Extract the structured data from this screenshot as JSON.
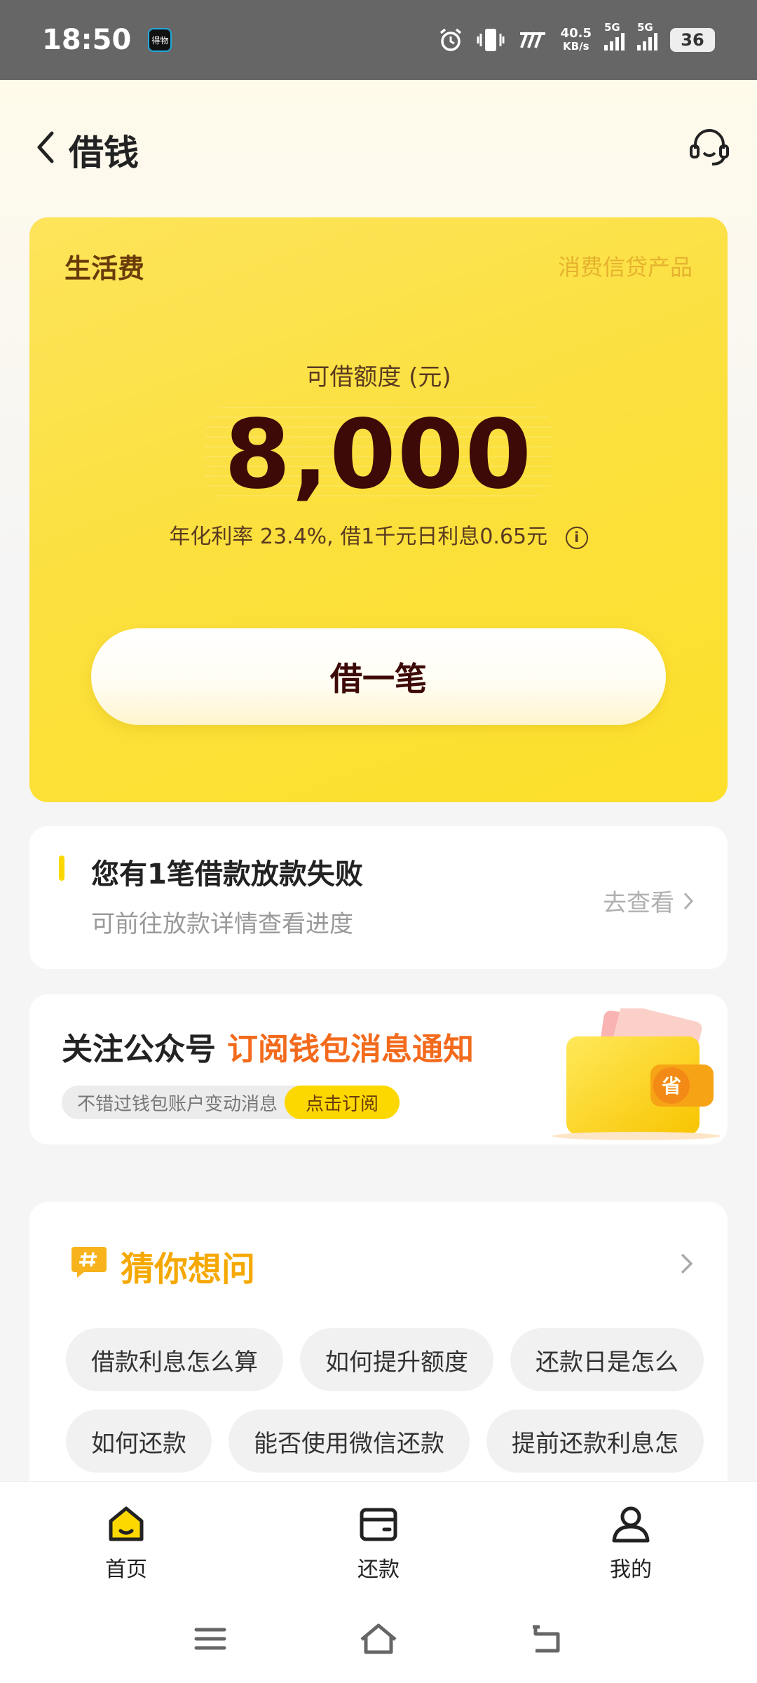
{
  "status_bar": {
    "time": "18:50",
    "app_badge": "得物",
    "net_speed_value": "40.5",
    "net_speed_unit": "KB/s",
    "signal1_label": "5G",
    "signal2_label": "5G",
    "battery": "36"
  },
  "header": {
    "title": "借钱"
  },
  "loan_card": {
    "product_name": "生活费",
    "product_tag": "消费信贷产品",
    "amount_label": "可借额度 (元)",
    "amount": "8,000",
    "rate_text": "年化利率 23.4%, 借1千元日利息0.65元",
    "info_icon": "i",
    "borrow_button": "借一笔"
  },
  "notice": {
    "title": "您有1笔借款放款失败",
    "subtitle": "可前往放款详情查看进度",
    "link": "去查看"
  },
  "subscribe": {
    "title_prefix": "关注公众号",
    "title_accent": "订阅钱包消息通知",
    "pill_text": "不错过钱包账户变动消息",
    "pill_button": "点击订阅",
    "wallet_badge": "省"
  },
  "faq": {
    "title": "猜你想问",
    "row1": [
      "借款利息怎么算",
      "如何提升额度",
      "还款日是怎么"
    ],
    "row2": [
      "如何还款",
      "能否使用微信还款",
      "提前还款利息怎"
    ]
  },
  "bottom_nav": {
    "home": "首页",
    "repay": "还款",
    "mine": "我的"
  },
  "colors": {
    "accent_yellow": "#fcd800",
    "amount_color": "#3d0a07",
    "accent_orange": "#f36a1c",
    "faq_title": "#f5a800"
  }
}
